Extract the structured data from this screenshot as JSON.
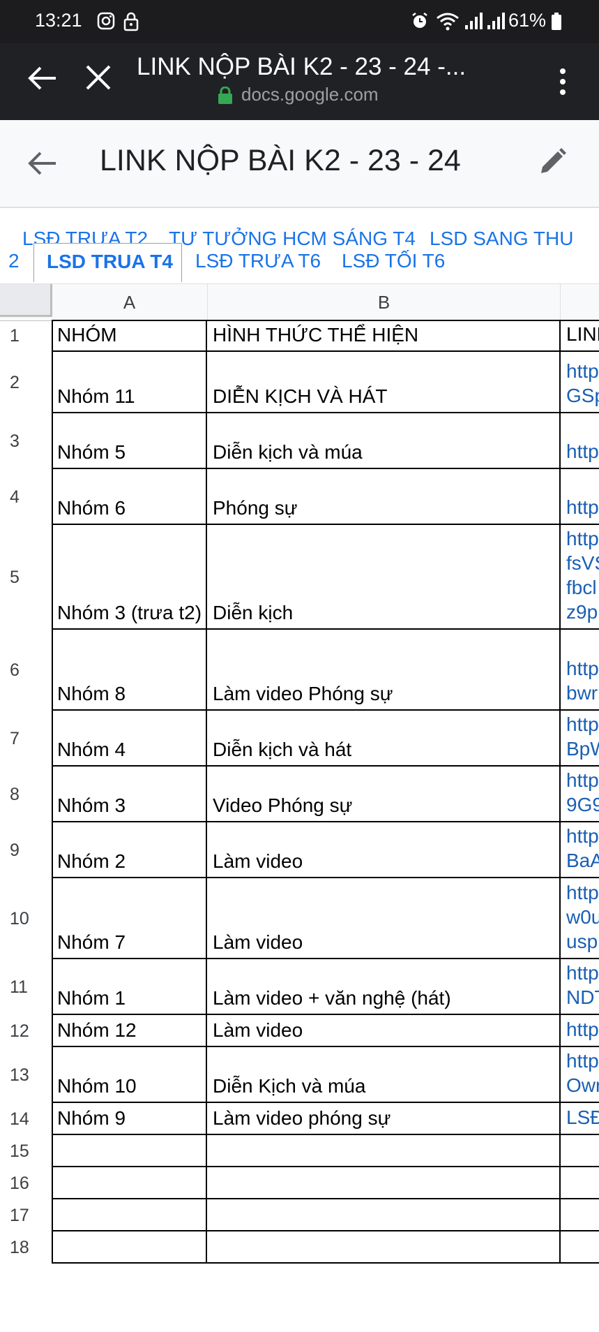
{
  "status_bar": {
    "time": "13:21",
    "battery": "61%",
    "icons": [
      "instagram-icon",
      "lock-icon",
      "alarm-icon",
      "wifi-icon",
      "signal-icon",
      "signal-icon",
      "battery-icon"
    ]
  },
  "browser": {
    "title": "LINK NỘP BÀI K2 - 23 - 24 -...",
    "url": "docs.google.com"
  },
  "doc": {
    "title": "LINK NỘP BÀI K2 - 23 - 24"
  },
  "tabs": {
    "row1": [
      "LSĐ TRƯA T2",
      "TƯ TƯỞNG HCM SÁNG T4",
      "LSD SANG THU"
    ],
    "row2_prefix": "2",
    "active": "LSD TRUA T4",
    "row2": [
      "LSĐ TRƯA T6",
      "LSĐ TỐI T6"
    ]
  },
  "columns": {
    "a": "A",
    "b": "B"
  },
  "rows": [
    {
      "n": "1",
      "a": "NHÓM",
      "b": "HÌNH THỨC THỂ HIỆN",
      "c": [
        "LINK"
      ]
    },
    {
      "n": "2",
      "a": "Nhóm 11",
      "b": "DIỄN KỊCH VÀ HÁT",
      "c": [
        "http",
        "GSp"
      ]
    },
    {
      "n": "3",
      "a": "Nhóm 5",
      "b": "Diễn kịch và múa",
      "c": [
        "http"
      ]
    },
    {
      "n": "4",
      "a": "Nhóm 6",
      "b": "Phóng sự",
      "c": [
        "http"
      ]
    },
    {
      "n": "5",
      "a": "Nhóm 3 (trưa t2)",
      "b": "Diễn kịch",
      "c": [
        "http",
        "fsVS",
        "fbcl",
        "z9p"
      ]
    },
    {
      "n": "6",
      "a": "Nhóm 8",
      "b": "Làm video Phóng sự",
      "c": [
        "http",
        "bwr"
      ]
    },
    {
      "n": "7",
      "a": "Nhóm 4",
      "b": "Diễn kịch và hát",
      "c": [
        "http",
        "BpW"
      ]
    },
    {
      "n": "8",
      "a": "Nhóm 3",
      "b": "Video Phóng sự",
      "c": [
        "http",
        "9G9"
      ]
    },
    {
      "n": "9",
      "a": "Nhóm 2",
      "b": "Làm video",
      "c": [
        "http",
        "BaA"
      ]
    },
    {
      "n": "10",
      "a": "Nhóm 7",
      "b": "Làm video",
      "c": [
        "http",
        "w0u",
        "usp"
      ]
    },
    {
      "n": "11",
      "a": "Nhóm 1",
      "b": "Làm video + văn nghệ (hát)",
      "c": [
        "http",
        "NDT"
      ]
    },
    {
      "n": "12",
      "a": "Nhóm 12",
      "b": "Làm video",
      "c": [
        "http"
      ]
    },
    {
      "n": "13",
      "a": "Nhóm 10",
      "b": "Diễn Kịch và múa",
      "c": [
        "http",
        "Owr"
      ]
    },
    {
      "n": "14",
      "a": "Nhóm 9",
      "b": "Làm video phóng sự",
      "c": [
        "LSĐ"
      ]
    },
    {
      "n": "15",
      "a": "",
      "b": "",
      "c": []
    },
    {
      "n": "16",
      "a": "",
      "b": "",
      "c": []
    },
    {
      "n": "17",
      "a": "",
      "b": "",
      "c": []
    },
    {
      "n": "18",
      "a": "",
      "b": "",
      "c": []
    }
  ]
}
